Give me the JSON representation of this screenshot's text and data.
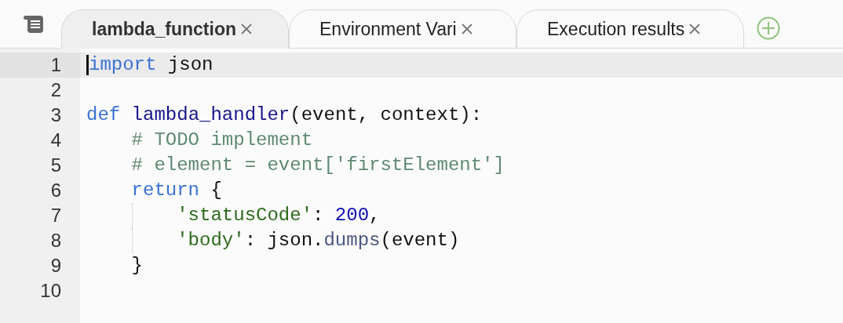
{
  "tabs": [
    {
      "label": "lambda_function",
      "selected": true
    },
    {
      "label": "Environment Vari",
      "selected": false
    },
    {
      "label": "Execution results",
      "selected": false
    }
  ],
  "editor": {
    "lines": [
      {
        "number": "1",
        "active": true,
        "indent_guide": false,
        "tokens": [
          {
            "text": "import",
            "kind": "keyword"
          },
          {
            "text": " json",
            "kind": "plain"
          }
        ]
      },
      {
        "number": "2",
        "active": false,
        "indent_guide": false
      },
      {
        "number": "3",
        "active": false,
        "indent_guide": false,
        "tokens": [
          {
            "text": "def",
            "kind": "keyword"
          },
          {
            "text": " lambda_handler",
            "kind": "function"
          },
          {
            "text": "(event, context):",
            "kind": "plain"
          }
        ]
      },
      {
        "number": "4",
        "active": false,
        "indent_guide": false,
        "tokens": [
          {
            "text": "    # TODO implement",
            "kind": "comment"
          }
        ]
      },
      {
        "number": "5",
        "active": false,
        "indent_guide": false,
        "tokens": [
          {
            "text": "    # element = event['firstElement']",
            "kind": "comment"
          }
        ]
      },
      {
        "number": "6",
        "active": false,
        "indent_guide": false,
        "tokens": [
          {
            "text": "    return",
            "kind": "keyword"
          },
          {
            "text": " {",
            "kind": "plain"
          }
        ]
      },
      {
        "number": "7",
        "active": false,
        "indent_guide": true,
        "tokens": [
          {
            "text": "        'statusCode'",
            "kind": "string"
          },
          {
            "text": ": ",
            "kind": "plain"
          },
          {
            "text": "200",
            "kind": "number"
          },
          {
            "text": ",",
            "kind": "plain"
          }
        ]
      },
      {
        "number": "8",
        "active": false,
        "indent_guide": true,
        "tokens": [
          {
            "text": "        'body'",
            "kind": "string"
          },
          {
            "text": ": json.",
            "kind": "plain"
          },
          {
            "text": "dumps",
            "kind": "method"
          },
          {
            "text": "(event)",
            "kind": "plain"
          }
        ]
      },
      {
        "number": "9",
        "active": false,
        "indent_guide": false,
        "tokens": [
          {
            "text": "    }",
            "kind": "plain"
          }
        ]
      },
      {
        "number": "10",
        "active": false,
        "indent_guide": false
      }
    ]
  }
}
